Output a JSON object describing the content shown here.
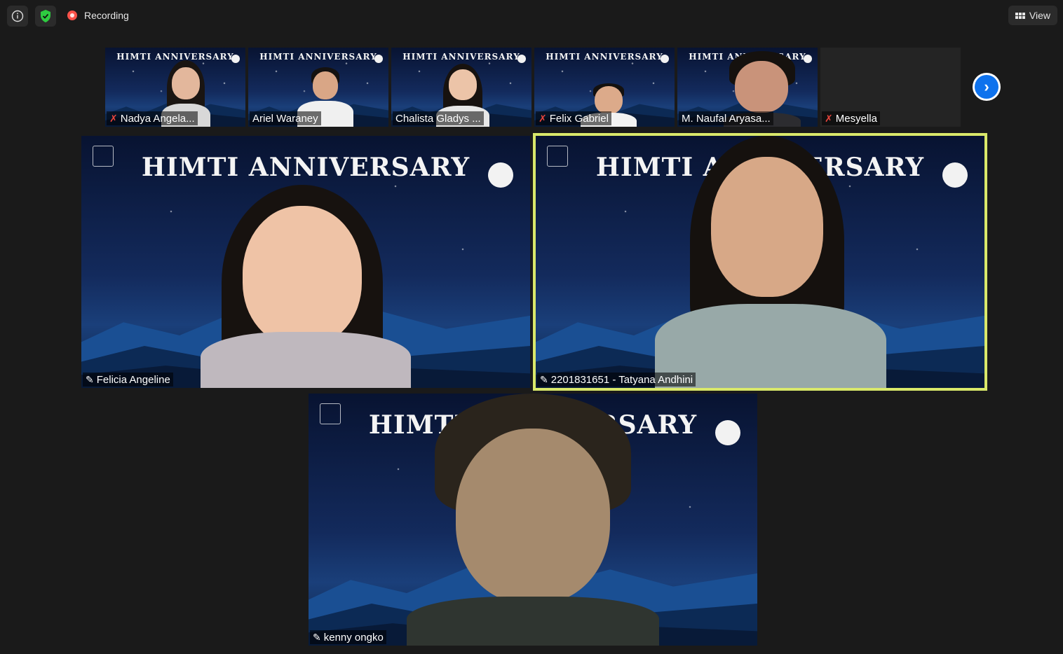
{
  "topbar": {
    "recording_label": "Recording",
    "view_label": "View"
  },
  "colors": {
    "active_speaker_border": "#d9e86a",
    "muted": "#e8453c",
    "record": "#f8524a",
    "next_button": "#0e72ed",
    "shield": "#2ecc40"
  },
  "banner_text": "HIMTI ANNIVERSARY",
  "gallery_strip": [
    {
      "name": "Nadya Angela...",
      "muted": true
    },
    {
      "name": "Ariel Waraney",
      "muted": false
    },
    {
      "name": "Chalista Gladys ...",
      "muted": false
    },
    {
      "name": "Felix Gabriel",
      "muted": true
    },
    {
      "name": "M. Naufal Aryasa...",
      "muted": false
    },
    {
      "name": "Mesyella",
      "muted": true,
      "video_off": true
    }
  ],
  "main_tiles": [
    {
      "name": "Felicia Angeline",
      "pinned": true,
      "active_speaker": false
    },
    {
      "name": "2201831651 - Tatyana Andhini",
      "pinned": true,
      "active_speaker": true
    },
    {
      "name": "kenny ongko",
      "pinned": true,
      "active_speaker": false
    }
  ],
  "icons": {
    "info": "info-icon",
    "security": "shield-check-icon",
    "record": "record-dot-icon",
    "view": "grid-view-icon",
    "muted": "mic-muted-icon",
    "pinned": "pin-icon",
    "next": "chevron-right-icon"
  }
}
